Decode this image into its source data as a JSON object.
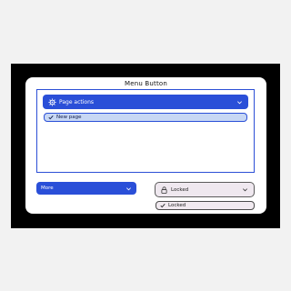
{
  "window": {
    "title": "Menu Button"
  },
  "menu": {
    "button_label": "Page actions",
    "button_icon": "gear-icon",
    "items": [
      {
        "label": "New page",
        "checked": true
      }
    ]
  },
  "more": {
    "label": "More"
  },
  "locked": {
    "button_label": "Locked",
    "button_icon": "lock-icon",
    "items": [
      {
        "label": "Locked",
        "checked": true
      }
    ]
  },
  "colors": {
    "accent": "#2a4fd8",
    "item_highlight": "#c7d7f4",
    "locked_bg": "#efe8ef"
  }
}
